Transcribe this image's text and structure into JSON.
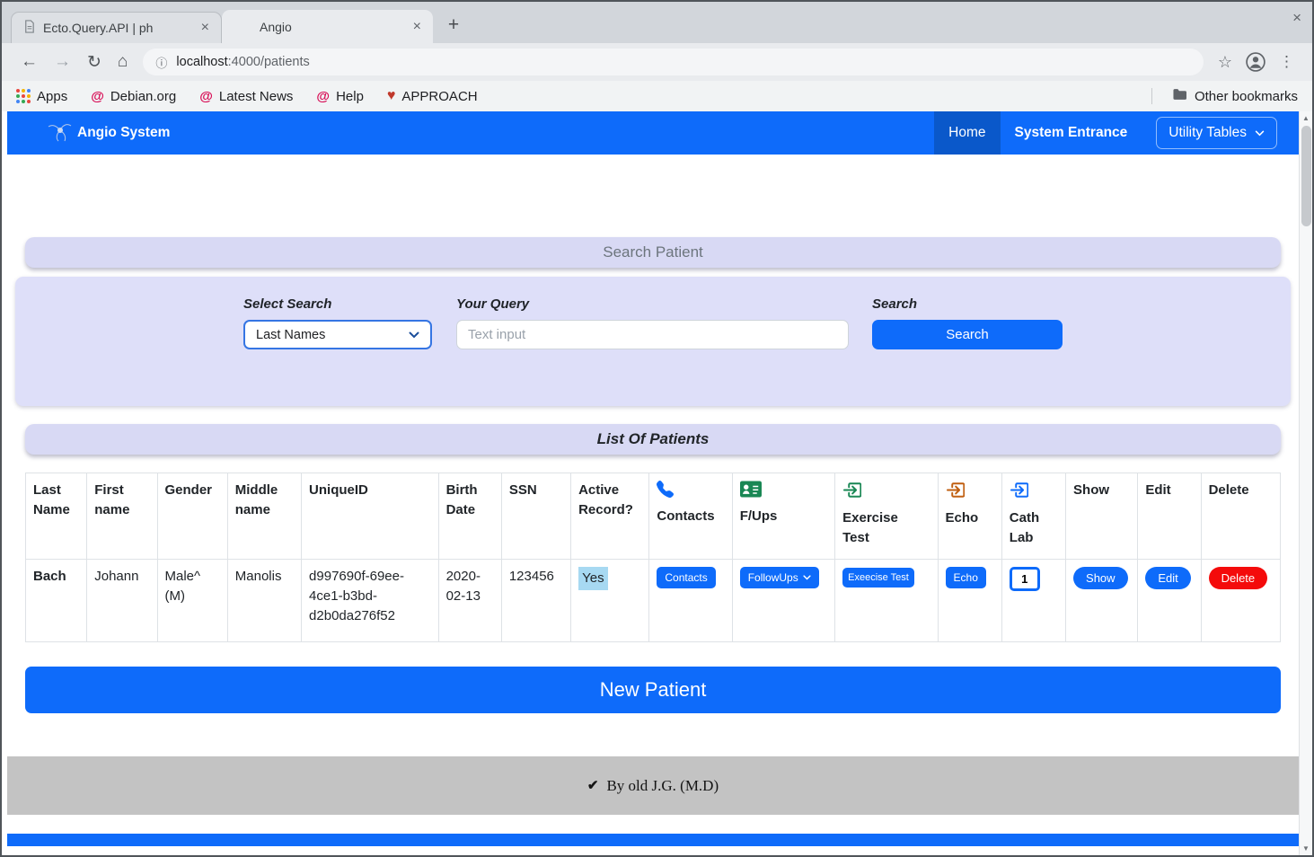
{
  "browser": {
    "tabs": [
      {
        "title": "Ecto.Query.API | ph",
        "active": false
      },
      {
        "title": "Angio",
        "active": true
      }
    ],
    "new_tab_label": "+",
    "address": {
      "host": "localhost",
      "path": ":4000/patients"
    },
    "bookmarks": {
      "items": [
        {
          "label": "Apps",
          "icon": "apps-grid-icon"
        },
        {
          "label": "Debian.org",
          "icon": "debian-swirl-icon"
        },
        {
          "label": "Latest News",
          "icon": "debian-swirl-icon"
        },
        {
          "label": "Help",
          "icon": "debian-swirl-icon"
        },
        {
          "label": "APPROACH",
          "icon": "heart-icon"
        }
      ],
      "other": "Other bookmarks"
    }
  },
  "navbar": {
    "brand": "Angio System",
    "home": "Home",
    "system_entrance": "System Entrance",
    "utility_tables": "Utility Tables"
  },
  "search": {
    "title": "Search Patient",
    "select_label": "Select Search",
    "select_value": "Last Names",
    "query_label": "Your Query",
    "query_placeholder": "Text input",
    "search_label": "Search",
    "button": "Search"
  },
  "patients": {
    "title": "List Of Patients",
    "headers": {
      "last_name": "Last Name",
      "first_name": "First name",
      "gender": "Gender",
      "middle_name": "Middle name",
      "unique_id": "UniqueID",
      "birth_date": "Birth Date",
      "ssn": "SSN",
      "active_record": "Active Record?",
      "contacts": "Contacts",
      "f_ups": "F/Ups",
      "exercise_test": "Exercise Test",
      "echo": "Echo",
      "cath_lab": "Cath Lab",
      "show": "Show",
      "edit": "Edit",
      "delete": "Delete"
    },
    "row": {
      "last_name": "Bach",
      "first_name": "Johann",
      "gender": "Male^ (M)",
      "middle_name": "Manolis",
      "unique_id": "d997690f-69ee-4ce1-b3bd-d2b0da276f52",
      "birth_date": "2020-02-13",
      "ssn": "123456",
      "active_record": "Yes",
      "contacts_button": "Contacts",
      "followups_button": "FollowUps",
      "exercise_button": "Exeecise Test",
      "echo_button": "Echo",
      "cath_lab_button": "1",
      "show_button": "Show",
      "edit_button": "Edit",
      "delete_button": "Delete"
    }
  },
  "new_patient_button": "New Patient",
  "footer": {
    "text": "By old J.G. (M.D)"
  },
  "colors": {
    "primary": "#0e6bfa",
    "primary_dark": "#0a58ca",
    "danger": "#f40b0b",
    "lavender_header": "#d8d9f4",
    "form_panel": "#dedff9",
    "yes_highlight": "#a7d9f2",
    "footer_gray": "#c3c3c3",
    "phone_icon": "#0e6bfa",
    "contact_card_icon": "#198754",
    "exercise_icon": "#198754",
    "echo_icon": "#c05f10",
    "cath_lab_icon": "#0e6bfa"
  }
}
